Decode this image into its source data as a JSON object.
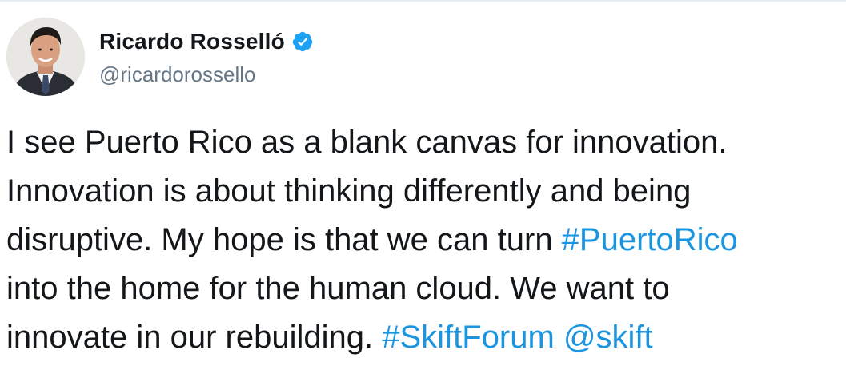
{
  "author": {
    "display_name": "Ricardo Rosselló",
    "handle": "@ricardorossello",
    "verified": true,
    "avatar_icon": "profile-photo-avatar"
  },
  "tweet": {
    "line1": "I see Puerto Rico as a blank canvas for innovation.",
    "line2": "Innovation is about thinking differently and being",
    "line3_text": "disruptive. My hope is that we can turn ",
    "line3_hashtag": "#PuertoRico",
    "line4": " into the home for the human cloud. We want to",
    "line5_text": "innovate in our rebuilding. ",
    "line5_hashtag": "#SkiftForum",
    "line5_mention": "@skift"
  },
  "colors": {
    "link": "#1b95e0",
    "text": "#14171a",
    "secondary": "#657786",
    "verified": "#1da1f2"
  }
}
